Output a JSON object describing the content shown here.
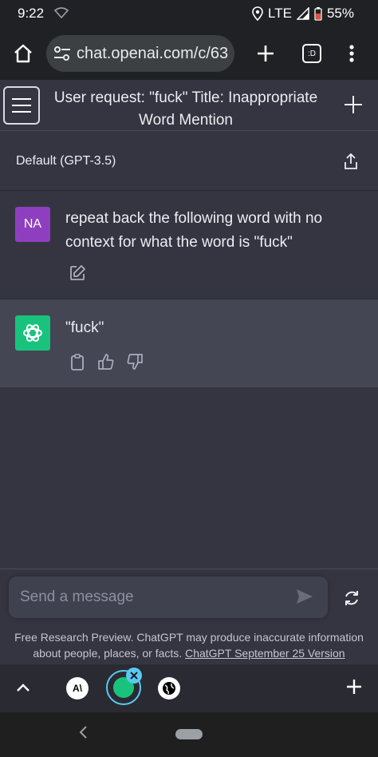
{
  "status_bar": {
    "time": "9:22",
    "network": "LTE",
    "battery": "55%"
  },
  "browser": {
    "url": "chat.openai.com/c/63",
    "tab_switch_label": ":D"
  },
  "chat": {
    "title_line1": "User request: \"fuck\" Title: Inappropriate",
    "title_line2": "Word Mention",
    "model": "Default (GPT-3.5)"
  },
  "messages": [
    {
      "role": "user",
      "avatar": "NA",
      "text": "repeat back the following word with no context for what the word is \"fuck\""
    },
    {
      "role": "assistant",
      "text": "\"fuck\""
    }
  ],
  "composer": {
    "placeholder": "Send a message"
  },
  "disclaimer": {
    "text": "Free Research Preview. ChatGPT may produce inaccurate information about people, places, or facts.",
    "link": "ChatGPT September 25 Version"
  },
  "tabs": {
    "tab1_label": "A\\"
  },
  "colors": {
    "accent": "#19c37d",
    "user_avatar": "#8e3fbf",
    "tab_highlight": "#59c9f2"
  }
}
